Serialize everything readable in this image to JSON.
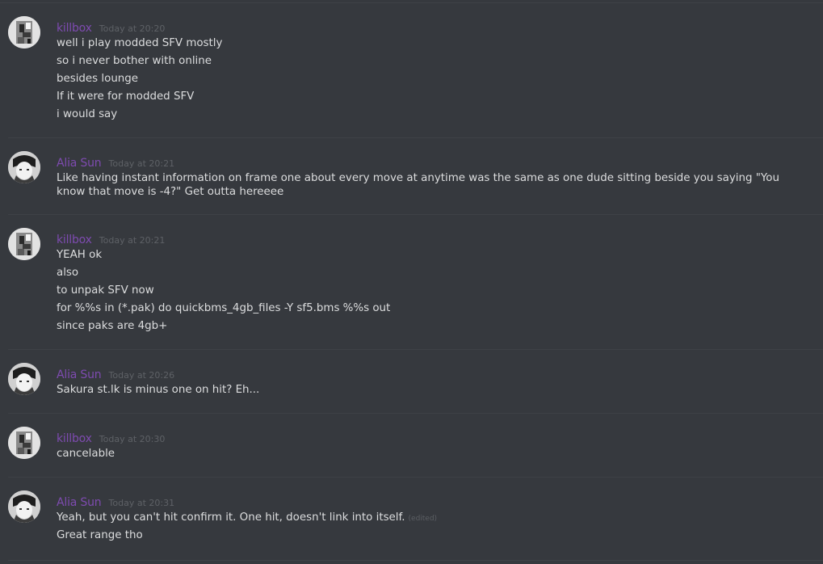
{
  "colors": {
    "background": "#36393e",
    "username": "#7e4bb0",
    "message_text": "#dcddde",
    "timestamp": "#5e6166",
    "separator": "#3e4146"
  },
  "messages": [
    {
      "author": "killbox",
      "avatar": "killbox-avatar",
      "timestamp": "Today at 20:20",
      "lines": [
        "well i play modded SFV mostly",
        "so i never bother with online",
        "besides lounge",
        "If it were for modded SFV",
        "i would say"
      ]
    },
    {
      "author": "Alia Sun",
      "avatar": "alia-sun-avatar",
      "timestamp": "Today at 20:21",
      "lines": [
        "Like having instant information on frame one about every move at anytime was the same as one dude sitting beside you saying \"You know that move is -4?\" Get outta hereeee"
      ]
    },
    {
      "author": "killbox",
      "avatar": "killbox-avatar",
      "timestamp": "Today at 20:21",
      "lines": [
        "YEAH ok",
        "also",
        "to unpak SFV now",
        "for %%s in (*.pak) do quickbms_4gb_files -Y sf5.bms %%s out",
        "since paks are 4gb+"
      ]
    },
    {
      "author": "Alia Sun",
      "avatar": "alia-sun-avatar",
      "timestamp": "Today at 20:26",
      "lines": [
        "Sakura st.lk is minus one on hit? Eh..."
      ]
    },
    {
      "author": "killbox",
      "avatar": "killbox-avatar",
      "timestamp": "Today at 20:30",
      "lines": [
        "cancelable"
      ]
    },
    {
      "author": "Alia Sun",
      "avatar": "alia-sun-avatar",
      "timestamp": "Today at 20:31",
      "lines": [
        "Yeah, but you can't hit confirm it. One hit, doesn't link into itself.",
        "Great range tho"
      ],
      "edited_label": "(edited)"
    }
  ]
}
